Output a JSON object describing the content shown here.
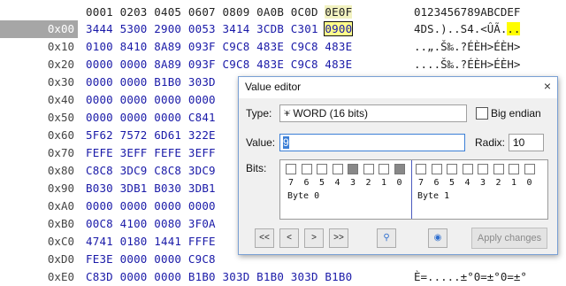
{
  "header": {
    "columns": "0001 0203 0405 0607 0809 0A0B 0C0D ",
    "cur_col": "0E0F",
    "ascii": "0123456789ABCDEF"
  },
  "rows": [
    {
      "off": "0x00",
      "bytes": "3444 5300 2900 0053 3414 3CDB C301 ",
      "cur": "0900",
      "ascii": "4DS.)..S4.<ÛÃ.",
      "ascii_hl": ".."
    },
    {
      "off": "0x10",
      "bytes": "0100 8410 8A89 093F C9C8 483E C9C8 483E",
      "ascii": "..„.Š‰.?ÉÈH>ÉÈH>"
    },
    {
      "off": "0x20",
      "bytes": "0000 0000 8A89 093F C9C8 483E C9C8 483E",
      "ascii": "....Š‰.?ÉÈH>ÉÈH>"
    },
    {
      "off": "0x30",
      "bytes": "0000 0000 B1B0 303D",
      "ascii": ""
    },
    {
      "off": "0x40",
      "bytes": "0000 0000 0000 0000",
      "ascii": ""
    },
    {
      "off": "0x50",
      "bytes": "0000 0000 0000 C841",
      "ascii": ""
    },
    {
      "off": "0x60",
      "bytes": "5F62 7572 6D61 322E",
      "ascii": ""
    },
    {
      "off": "0x70",
      "bytes": "FEFE 3EFF FEFE 3EFF",
      "ascii": ""
    },
    {
      "off": "0x80",
      "bytes": "C8C8 3DC9 C8C8 3DC9",
      "ascii": ""
    },
    {
      "off": "0x90",
      "bytes": "B030 3DB1 B030 3DB1",
      "ascii": ""
    },
    {
      "off": "0xA0",
      "bytes": "0000 0000 0000 0000",
      "ascii": ""
    },
    {
      "off": "0xB0",
      "bytes": "00C8 4100 0080 3F0A",
      "ascii": ""
    },
    {
      "off": "0xC0",
      "bytes": "4741 0180 1441 FFFE",
      "ascii": ""
    },
    {
      "off": "0xD0",
      "bytes": "FE3E 0000 0000 C9C8",
      "ascii": ""
    },
    {
      "off": "0xE0",
      "bytes": "C83D 0000 0000 B1B0 303D B1B0 303D B1B0",
      "ascii": "È=.....±°0=±°0=±°"
    }
  ],
  "dialog": {
    "title": "Value editor",
    "close": "×",
    "type_label": "Type:",
    "type_value": "+ WORD (16 bits)",
    "big_endian": "Big endian",
    "value_label": "Value:",
    "value": "9",
    "radix_label": "Radix:",
    "radix_value": "10",
    "bits_label": "Bits:",
    "bit_numbers": [
      "7",
      "6",
      "5",
      "4",
      "3",
      "2",
      "1",
      "0",
      "7",
      "6",
      "5",
      "4",
      "3",
      "2",
      "1",
      "0"
    ],
    "bit_states": [
      0,
      0,
      0,
      0,
      1,
      0,
      0,
      1,
      0,
      0,
      0,
      0,
      0,
      0,
      0,
      0
    ],
    "byte0": "Byte 0",
    "byte1": "Byte 1",
    "nav": [
      "<<",
      "<",
      ">",
      ">>"
    ],
    "apply": "Apply changes"
  }
}
